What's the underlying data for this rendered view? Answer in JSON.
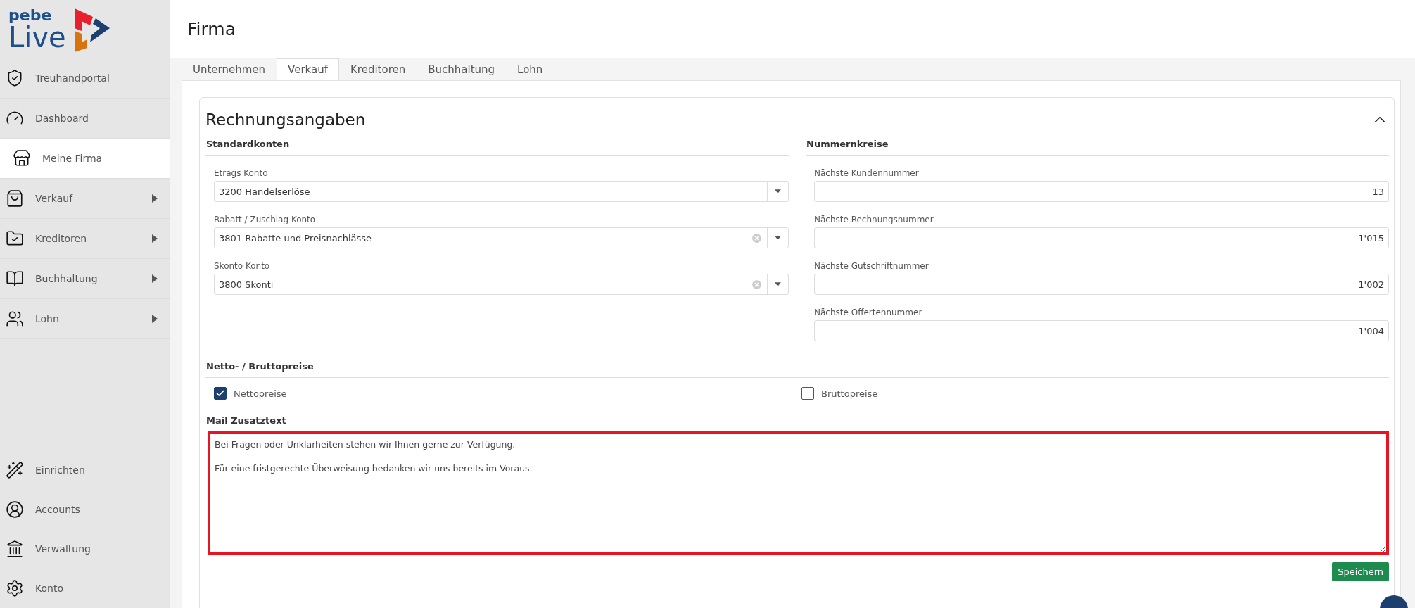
{
  "logo": {
    "line_1": "pebe",
    "line_2": "Live"
  },
  "sidebar": {
    "items": [
      {
        "label": "Treuhandportal",
        "selected": false,
        "has_submenu": false
      },
      {
        "label": "Dashboard",
        "selected": false,
        "has_submenu": false
      },
      {
        "label": "Meine Firma",
        "selected": true,
        "has_submenu": false
      },
      {
        "label": "Verkauf",
        "selected": false,
        "has_submenu": true
      },
      {
        "label": "Kreditoren",
        "selected": false,
        "has_submenu": true
      },
      {
        "label": "Buchhaltung",
        "selected": false,
        "has_submenu": true
      },
      {
        "label": "Lohn",
        "selected": false,
        "has_submenu": true
      }
    ],
    "bottom_items": [
      {
        "label": "Einrichten"
      },
      {
        "label": "Accounts"
      },
      {
        "label": "Verwaltung"
      },
      {
        "label": "Konto"
      }
    ]
  },
  "page": {
    "title": "Firma"
  },
  "tabs": [
    {
      "label": "Unternehmen",
      "selected": false
    },
    {
      "label": "Verkauf",
      "selected": true
    },
    {
      "label": "Kreditoren",
      "selected": false
    },
    {
      "label": "Buchhaltung",
      "selected": false
    },
    {
      "label": "Lohn",
      "selected": false
    }
  ],
  "card": {
    "title": "Rechnungsangaben",
    "expanded": true,
    "standardkonten": {
      "title": "Standardkonten",
      "fields": [
        {
          "label": "Etrags Konto",
          "value": "3200 Handelserlöse",
          "clearable": false
        },
        {
          "label": "Rabatt / Zuschlag Konto",
          "value": "3801 Rabatte und Preisnachlässe",
          "clearable": true
        },
        {
          "label": "Skonto Konto",
          "value": "3800 Skonti",
          "clearable": true
        }
      ]
    },
    "nummernkreise": {
      "title": "Nummernkreise",
      "fields": [
        {
          "label": "Nächste Kundennummer",
          "value": "13"
        },
        {
          "label": "Nächste Rechnungsnummer",
          "value": "1'015"
        },
        {
          "label": "Nächste Gutschriftnummer",
          "value": "1'002"
        },
        {
          "label": "Nächste Offertennummer",
          "value": "1'004"
        }
      ]
    },
    "preise": {
      "title": "Netto- / Bruttopreise",
      "options": [
        {
          "label": "Nettopreise",
          "checked": true
        },
        {
          "label": "Bruttopreise",
          "checked": false
        }
      ]
    },
    "mail": {
      "title": "Mail Zusatztext",
      "value": "Bei Fragen oder Unklarheiten stehen wir Ihnen gerne zur Verfügung.\n\nFür eine fristgerechte Überweisung bedanken wir uns bereits im Voraus.",
      "highlighted": true
    },
    "save_button": "Speichern"
  }
}
